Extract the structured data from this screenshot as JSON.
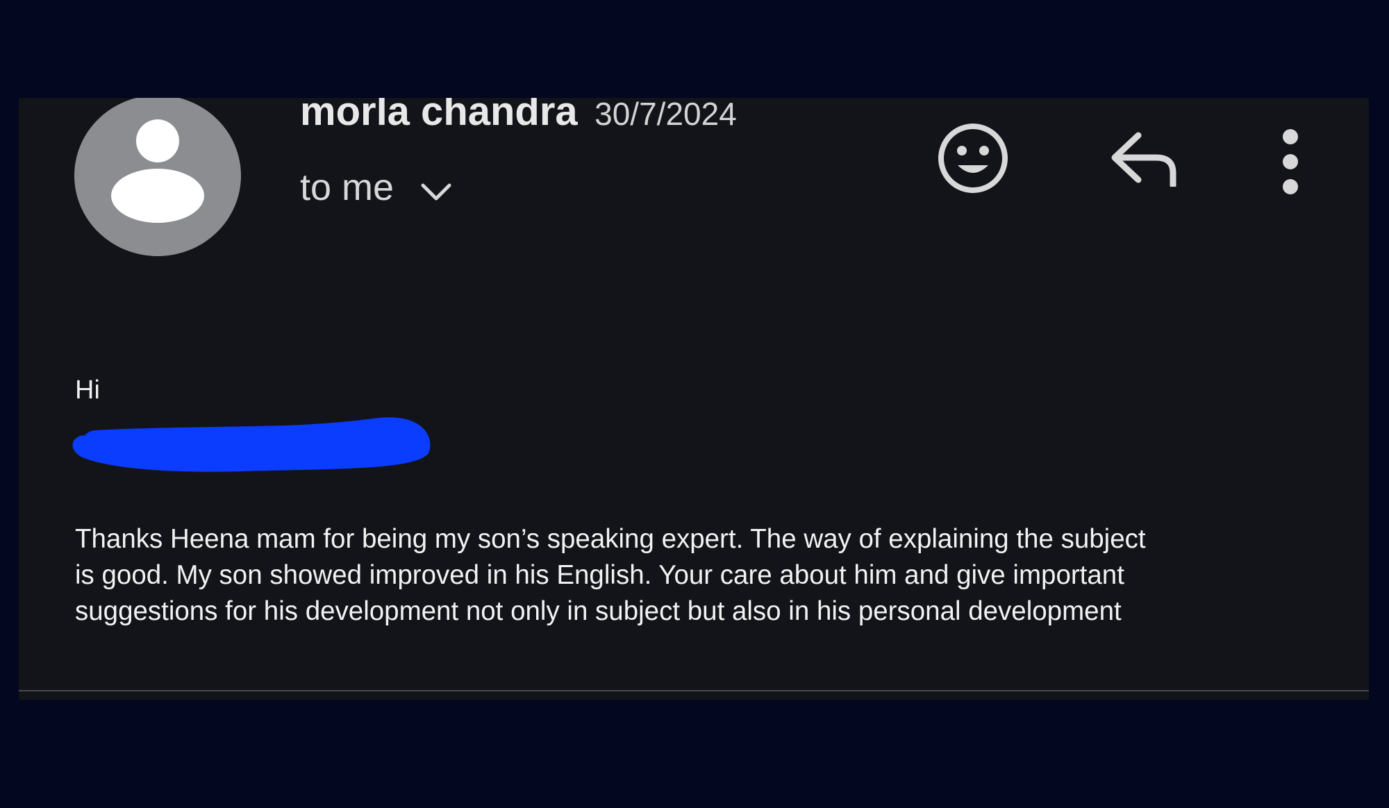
{
  "header": {
    "sender_name": "morla chandra",
    "date": "30/7/2024",
    "recipient_label": "to me"
  },
  "icons": {
    "avatar": "person-icon",
    "expand": "chevron-down-icon",
    "react": "smiley-icon",
    "reply": "reply-icon",
    "more": "more-vertical-icon"
  },
  "body": {
    "greeting": "Hi",
    "redaction_color": "#0a3dff",
    "lines": [
      "Thanks Heena mam for being my son’s speaking expert. The way of explaining the subject",
      "is good. My son showed improved in his English. Your care about him and give important",
      "suggestions for his development not only in subject but also in his personal development"
    ]
  },
  "colors": {
    "page_background": "#03071f",
    "card_background": "#131419",
    "avatar_background": "#8b8d91",
    "text": "#f2f2f2"
  }
}
